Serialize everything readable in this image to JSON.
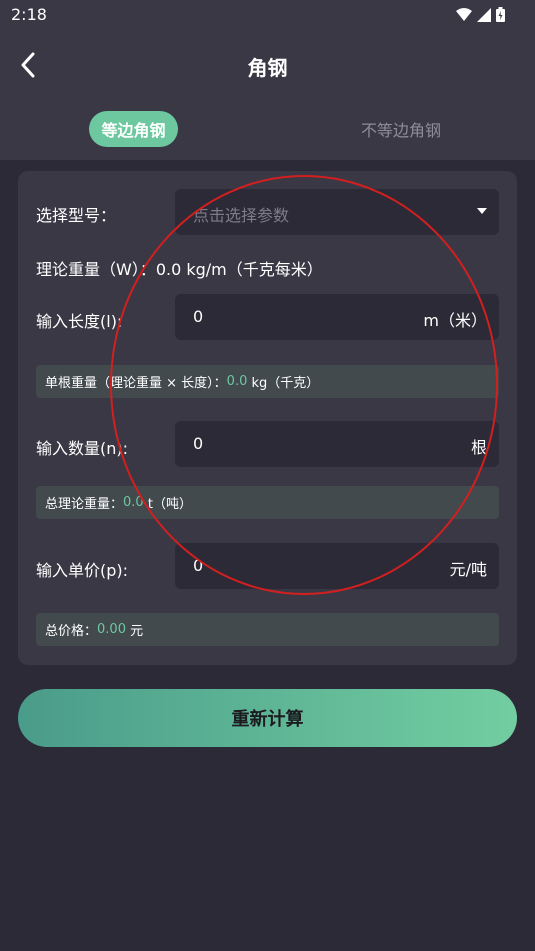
{
  "status": {
    "time": "2:18"
  },
  "header": {
    "title": "角钢"
  },
  "tabs": [
    {
      "label": "等边角钢"
    },
    {
      "label": "不等边角钢"
    }
  ],
  "form": {
    "model_label": "选择型号：",
    "model_placeholder": "点击选择参数",
    "weight_label": "理论重量（W）：",
    "weight_value": "0.0 kg/m（千克每米）",
    "length_label": "输入长度(l):",
    "length_value": "0",
    "length_unit": "m（米）",
    "single_weight_label": "单根重量（理论重量 × 长度）：",
    "single_weight_value": "0.0",
    "single_weight_unit": "kg（千克）",
    "quantity_label": "输入数量(n):",
    "quantity_value": "0",
    "quantity_unit": "根",
    "total_weight_label": "总理论重量：",
    "total_weight_value": "0.0",
    "total_weight_unit": "t（吨）",
    "price_label": "输入单价(p):",
    "price_value": "0",
    "price_unit": "元/吨",
    "total_price_label": "总价格：",
    "total_price_value": "0.00",
    "total_price_unit": "元"
  },
  "actions": {
    "recalculate_label": "重新计算"
  },
  "colors": {
    "accent": "#6dc89f",
    "background": "#2b2a36",
    "card": "#393844",
    "annotation": "#d21f1f"
  }
}
